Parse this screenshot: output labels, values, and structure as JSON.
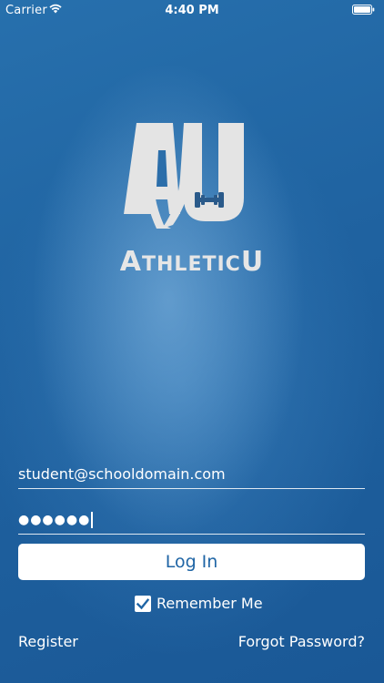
{
  "status_bar": {
    "carrier": "Carrier",
    "time": "4:40 PM"
  },
  "brand": {
    "logo_letters": "AU",
    "name_prefix": "A",
    "name_middle": "thletic",
    "name_suffix": "U"
  },
  "form": {
    "email_value": "student@schooldomain.com",
    "password_mask": "●●●●●●",
    "login_label": "Log In",
    "remember_label": "Remember Me",
    "remember_checked": true
  },
  "links": {
    "register": "Register",
    "forgot_password": "Forgot Password?"
  },
  "colors": {
    "background": "#1f62a0",
    "accent": "#1f65a5",
    "text": "#ffffff"
  }
}
